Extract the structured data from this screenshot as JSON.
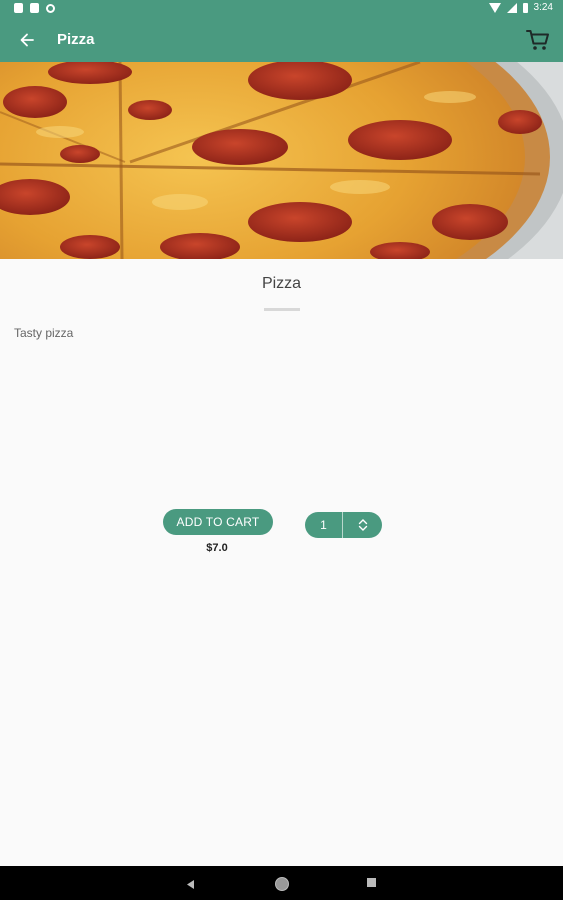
{
  "status_bar": {
    "time": "3:24"
  },
  "app_bar": {
    "title": "Pizza"
  },
  "product": {
    "name": "Pizza",
    "description": "Tasty pizza",
    "price": "$7.0",
    "quantity": "1",
    "add_to_cart_label": "ADD TO CART"
  },
  "colors": {
    "primary": "#4a9a80",
    "background": "#fafafa",
    "nav_bar": "#000000"
  },
  "icons": {
    "back": "arrow-left-icon",
    "cart": "shopping-cart-icon",
    "qty_up": "chevron-up-icon",
    "qty_down": "chevron-down-icon"
  }
}
